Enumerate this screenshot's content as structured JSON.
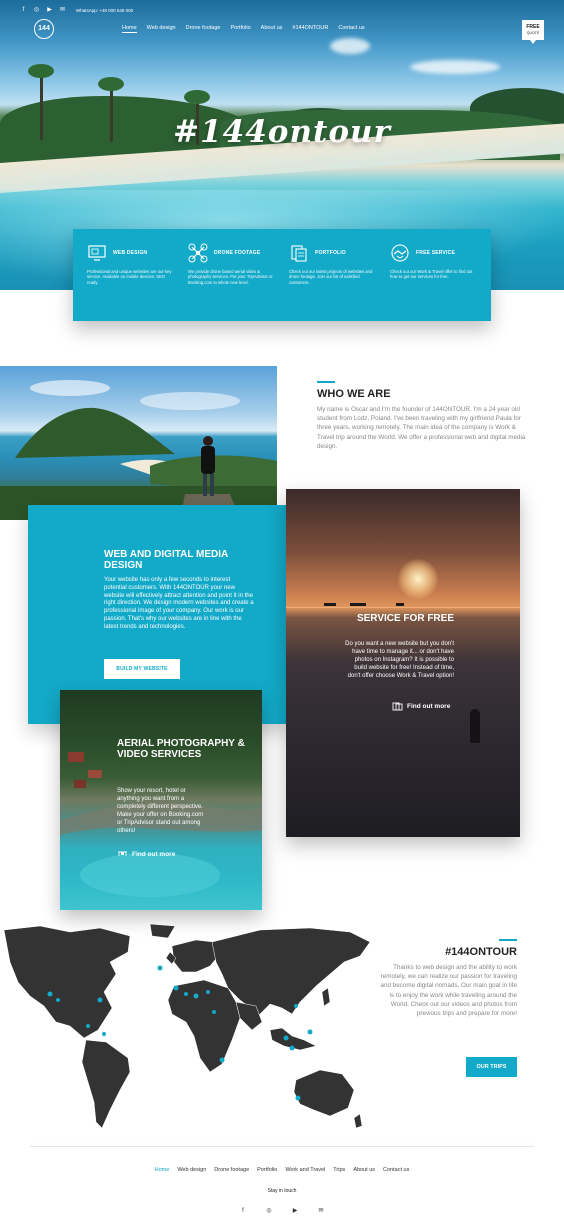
{
  "topbar": {
    "social_icons": [
      "facebook-icon",
      "instagram-icon",
      "youtube-icon",
      "mail-icon"
    ],
    "phone": "WhatsApp: +48 000 548 000"
  },
  "logo": {
    "text": "144"
  },
  "nav": {
    "items": [
      "Home",
      "Web design",
      "Drone footage",
      "Portfolio",
      "About us",
      "#144ONTOUR",
      "Contact us"
    ],
    "active": "Home"
  },
  "quote": {
    "line1": "FREE",
    "line2": "QUOTE"
  },
  "hero": {
    "title": "#144ontour"
  },
  "services": [
    {
      "title": "WEB DESIGN",
      "icon": "monitor-icon",
      "text": "Professional and unique websites are our key service. Available on mobile devices, SEO ready."
    },
    {
      "title": "DRONE FOOTAGE",
      "icon": "drone-icon",
      "text": "We provide drone based aerial video & photography services. Put your TripAdvisor or Booking.com to whole new level."
    },
    {
      "title": "PORTFOLIO",
      "icon": "portfolio-icon",
      "text": "Check out our latest projects of websites and drone footage. Join our list of satisfied customers."
    },
    {
      "title": "FREE SERVICE",
      "icon": "handshake-icon",
      "text": "Check out our Work & Travel offer to find out how to get our services for free."
    }
  ],
  "who": {
    "title": "WHO WE ARE",
    "text": "My name is Oscar and I'm the founder of 144ONTOUR. I'm a 24 year old student from Lodz, Poland. I've been traveling with my girlfriend Paula for three years, working remotely. The main idea of the company is Work & Travel trip around the World. We offer a professional web and digital media design."
  },
  "web_card": {
    "title": "WEB AND DIGITAL MEDIA DESIGN",
    "text": "Your website has only a few seconds to interest potential customers. With 144ONTOUR your new website will effectively attract attention and point it in the right direction. We design modern websites and create a professional image of your company. Our work is our passion. That's why our websites are in line with the latest trends and technologies.",
    "button": "BUILD MY WEBSITE"
  },
  "free_card": {
    "title": "SERVICE FOR FREE",
    "text": "Do you want a new website but you don't have time to manage it... or don't have photos on Instagram? It is possible to build website for free! Instead of time, don't offer choose Work & Travel option!",
    "link": "Find out more"
  },
  "aerial_card": {
    "title": "AERIAL PHOTOGRAPHY & VIDEO SERVICES",
    "text": "Show your resort, hotel or anything you want from a completely different perspective. Make your offer on Booking.com or TripAdvisor stand out among others!",
    "link": "Find out more"
  },
  "map_section": {
    "title": "#144ONTOUR",
    "text": "Thanks to web design and the ability to work remotely, we can realize our passion for traveling and become digital nomads. Our main goal in life is to enjoy the work while traveling around the World. Check out our videos and photos from previous trips and prepare for more!",
    "button": "OUR TRIPS"
  },
  "footer": {
    "nav": [
      "Home",
      "Web design",
      "Drone footage",
      "Portfolio",
      "Work and Travel",
      "Trips",
      "About us",
      "Contact us"
    ],
    "active": "Home",
    "stay": "Stay in touch",
    "social_icons": [
      "facebook-icon",
      "instagram-icon",
      "youtube-icon",
      "mail-icon"
    ]
  },
  "colors": {
    "accent": "#13a9c8",
    "text_dark": "#222222",
    "text_muted": "#888888"
  }
}
